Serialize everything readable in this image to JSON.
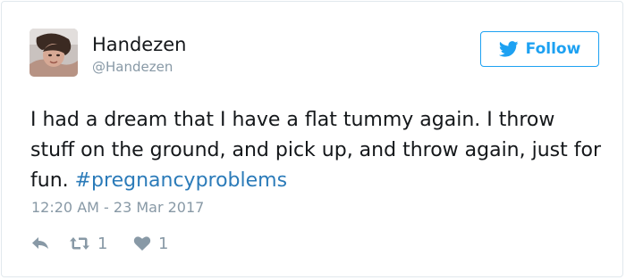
{
  "tweet": {
    "author": {
      "display_name": "Handezen",
      "handle": "@Handezen",
      "avatar_icon": "profile-photo"
    },
    "follow_button": {
      "label": "Follow",
      "icon": "twitter-bird-icon"
    },
    "text": {
      "body": "I had a dream that I have a flat tummy again. I throw stuff on the ground, and pick up, and throw again, just for fun. ",
      "hashtag": "#pregnancyproblems"
    },
    "timestamp": "12:20 AM - 23 Mar 2017",
    "actions": {
      "reply_icon": "reply-icon",
      "retweet_icon": "retweet-icon",
      "retweet_count": "1",
      "like_icon": "heart-icon",
      "like_count": "1"
    }
  },
  "colors": {
    "accent": "#1da1f2",
    "hashtag": "#2b7bb9",
    "muted": "#8899a6",
    "text": "#14171a",
    "border": "#e1e8ed"
  }
}
